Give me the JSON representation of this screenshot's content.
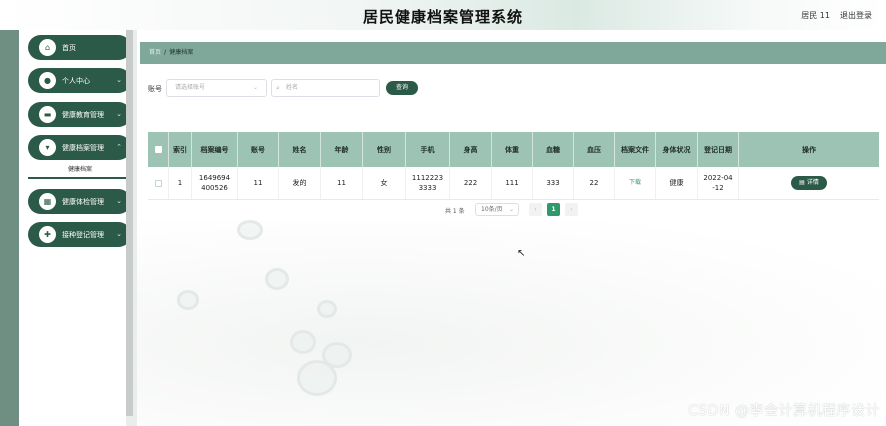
{
  "header": {
    "title": "居民健康档案管理系统",
    "user": "居民 11",
    "logout": "退出登录"
  },
  "sidebar": {
    "items": [
      {
        "label": "首页",
        "icon": "home-icon"
      },
      {
        "label": "个人中心",
        "icon": "user-icon"
      },
      {
        "label": "健康教育管理",
        "icon": "book-icon"
      },
      {
        "label": "健康档案管理",
        "icon": "folder-icon"
      },
      {
        "label": "健康体检管理",
        "icon": "grid-icon"
      },
      {
        "label": "接种登记管理",
        "icon": "syringe-icon"
      }
    ],
    "sub_item": "健康档案"
  },
  "breadcrumb": {
    "home": "首页",
    "separator": "/",
    "current": "健康档案"
  },
  "search": {
    "account_label": "账号",
    "account_placeholder": "请选择账号",
    "name_placeholder": "姓名",
    "query_button": "查询"
  },
  "table": {
    "headers": [
      "索引",
      "档案编号",
      "账号",
      "姓名",
      "年龄",
      "性别",
      "手机",
      "身高",
      "体重",
      "血糖",
      "血压",
      "档案文件",
      "身体状况",
      "登记日期",
      "操作"
    ],
    "rows": [
      {
        "index": "1",
        "record_no": "1649694400526",
        "account": "11",
        "name": "发的",
        "age": "11",
        "gender": "女",
        "phone": "11122233333",
        "height": "222",
        "weight": "111",
        "blood_sugar": "333",
        "blood_pressure": "22",
        "file": "下载",
        "condition": "健康",
        "date": "2022-04-12",
        "action": "详情"
      }
    ]
  },
  "pagination": {
    "total": "共 1 条",
    "page_size": "10条/页",
    "prev": "‹",
    "current": "1",
    "next": "›"
  },
  "watermark": "CSDN @李会计算机程序设计",
  "colors": {
    "primary": "#2c5a49",
    "table_header": "#9dc3b4",
    "breadcrumb_bar": "#7fa89a",
    "page_active": "#2e9a6b"
  }
}
